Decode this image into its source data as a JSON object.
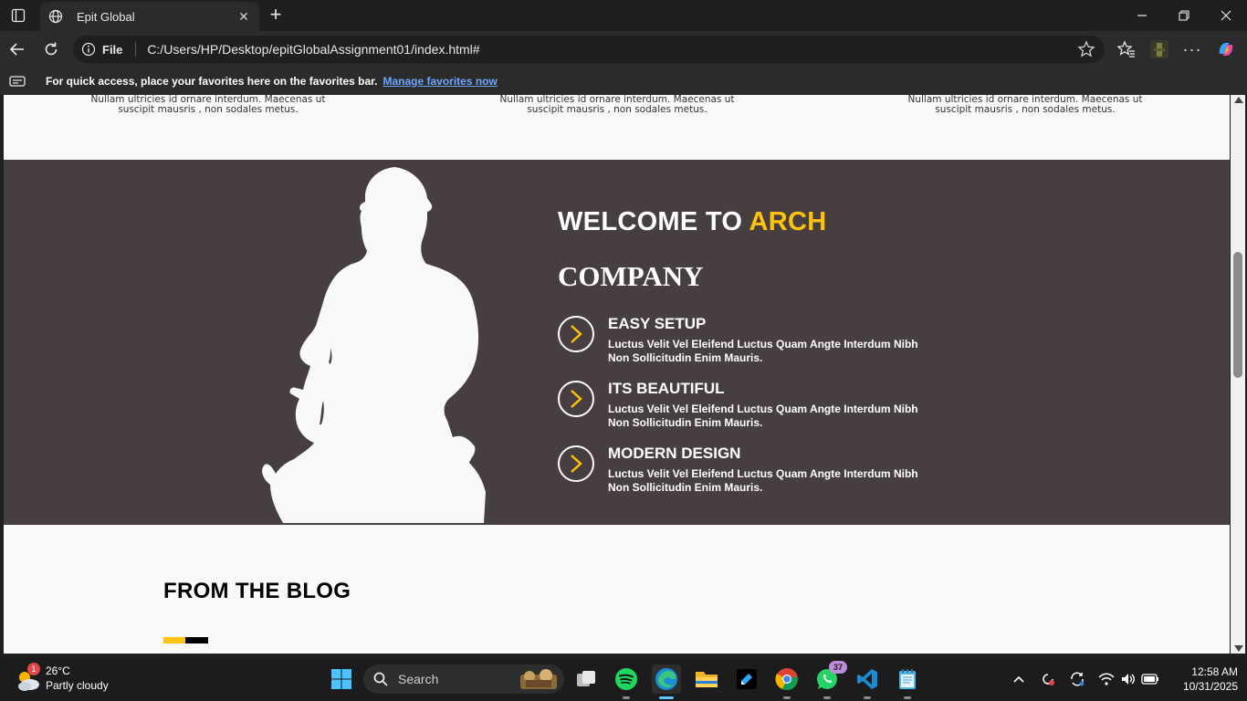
{
  "browser": {
    "tab_title": "Epit Global",
    "url_scheme": "File",
    "url": "C:/Users/HP/Desktop/epitGlobalAssignment01/index.html#",
    "favbar_message": "For quick access, place your favorites here on the favorites bar.",
    "favbar_link": "Manage favorites now"
  },
  "page": {
    "feature_text": [
      "Nullam ultricies id ornare interdum. Maecenas ut suscipit mausris , non sodales metus.",
      "Nullam ultricies id ornare interdum. Maecenas ut suscipit mausris , non sodales metus.",
      "Nullam ultricies id ornare interdum. Maecenas ut suscipit mausris , non sodales metus."
    ],
    "welcome": {
      "heading_white": "WELCOME TO ",
      "heading_accent": "ARCH",
      "heading_line2": "COMPANY",
      "items": [
        {
          "title": "EASY SETUP",
          "desc": "Luctus Velit Vel Eleifend Luctus Quam Angte Interdum Nibh Non Sollicitudin Enim Mauris."
        },
        {
          "title": "ITS BEAUTIFUL",
          "desc": "Luctus Velit Vel Eleifend Luctus Quam Angte Interdum Nibh Non Sollicitudin Enim Mauris."
        },
        {
          "title": "MODERN DESIGN",
          "desc": "Luctus Velit Vel Eleifend Luctus Quam Angte Interdum Nibh Non Sollicitudin Enim Mauris."
        }
      ]
    },
    "blog_title": "FROM THE BLOG"
  },
  "taskbar": {
    "weather_temp": "26°C",
    "weather_cond": "Partly cloudy",
    "weather_badge": "1",
    "search_label": "Search",
    "whatsapp_badge": "37",
    "time": "12:58 AM",
    "date": "10/31/2025"
  },
  "colors": {
    "accent": "#ffc20e",
    "section_bg": "#473f3f",
    "page_bg": "#f9f9f9"
  }
}
